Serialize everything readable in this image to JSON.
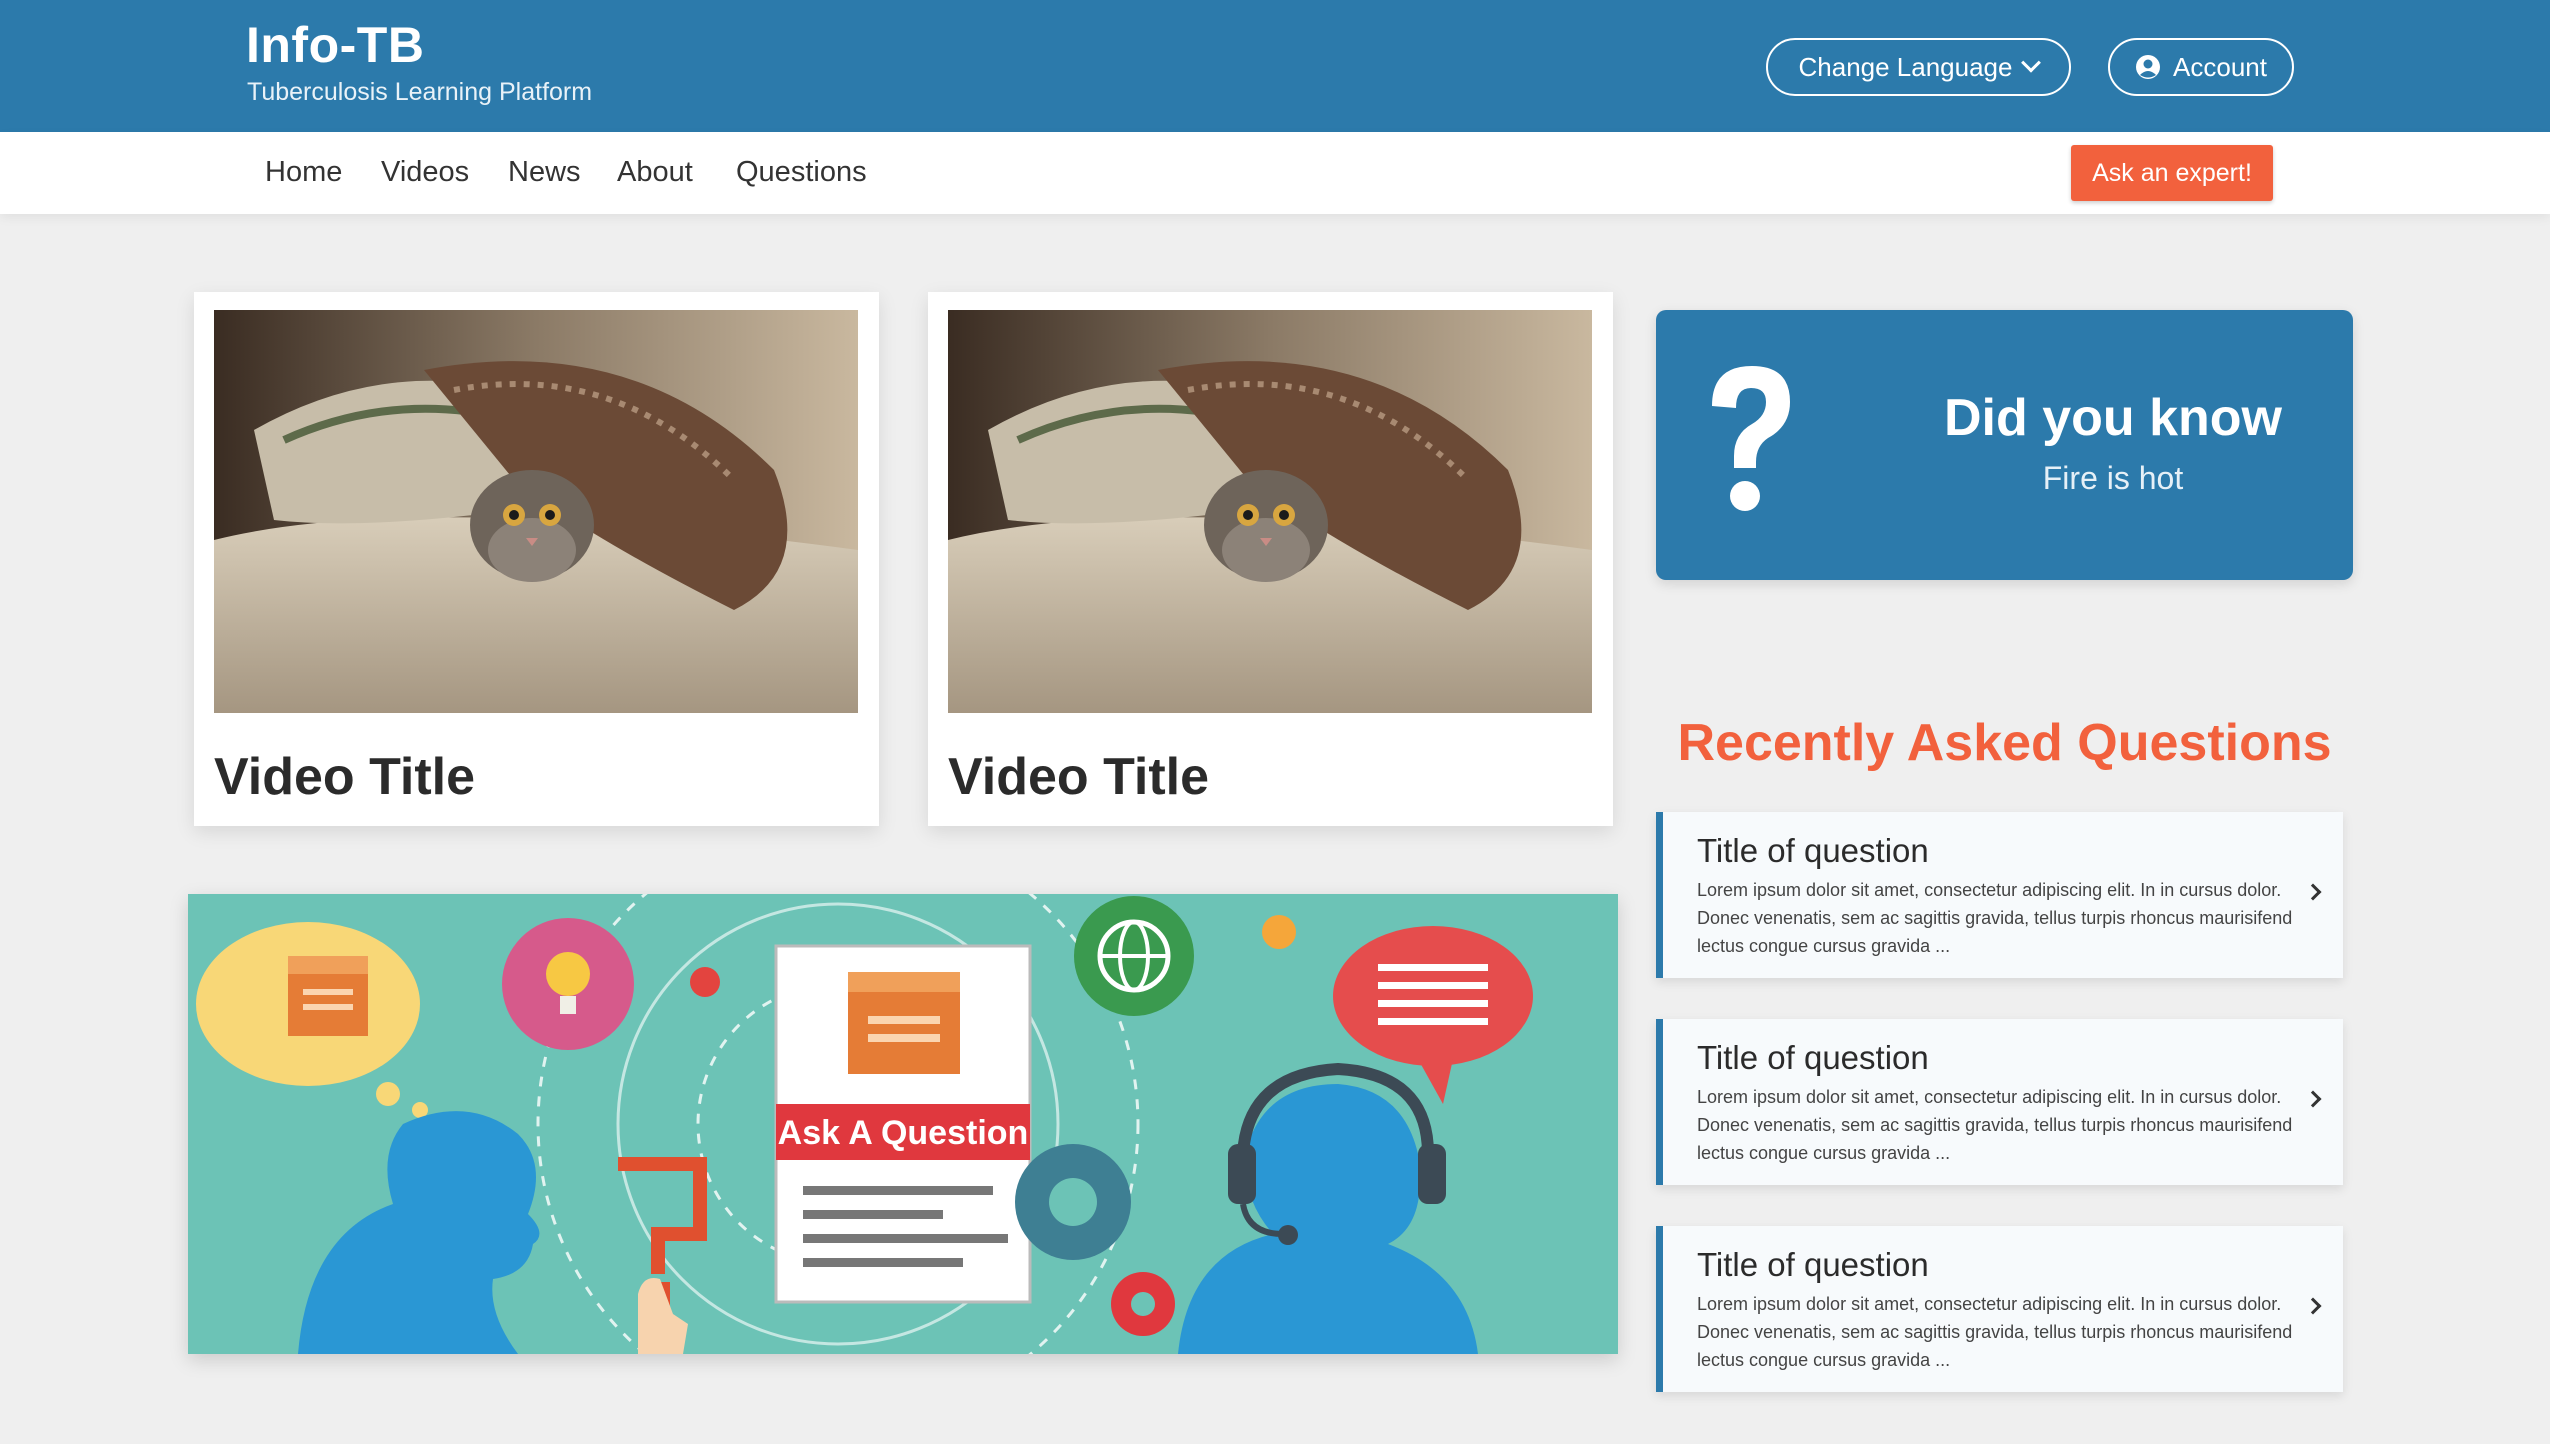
{
  "header": {
    "title": "Info-TB",
    "subtitle": "Tuberculosis Learning Platform",
    "language_label": "Change Language",
    "account_label": "Account"
  },
  "nav": {
    "items": [
      "Home",
      "Videos",
      "News",
      "About",
      "Questions"
    ],
    "cta": "Ask an expert!"
  },
  "videos": [
    {
      "title": "Video Title"
    },
    {
      "title": "Video Title"
    }
  ],
  "did_you_know": {
    "title": "Did you know",
    "fact": "Fire is hot"
  },
  "banner": {
    "label": "Ask A Question"
  },
  "recent_questions": {
    "heading": "Recently Asked Questions",
    "items": [
      {
        "title": "Title of question",
        "excerpt": "Lorem ipsum dolor sit amet, consectetur adipiscing elit. In in cursus dolor. Donec venenatis, sem ac sagittis gravida, tellus turpis rhoncus maurisifend lectus congue cursus gravida ..."
      },
      {
        "title": "Title of question",
        "excerpt": "Lorem ipsum dolor sit amet, consectetur adipiscing elit. In in cursus dolor. Donec venenatis, sem ac sagittis gravida, tellus turpis rhoncus maurisifend lectus congue cursus gravida ..."
      },
      {
        "title": "Title of question",
        "excerpt": "Lorem ipsum dolor sit amet, consectetur adipiscing elit. In in cursus dolor. Donec venenatis, sem ac sagittis gravida, tellus turpis rhoncus maurisifend lectus congue cursus gravida ..."
      }
    ]
  },
  "colors": {
    "brand_blue": "#2c7aab",
    "accent_orange": "#f2613d",
    "banner_teal": "#6cc3b6"
  }
}
